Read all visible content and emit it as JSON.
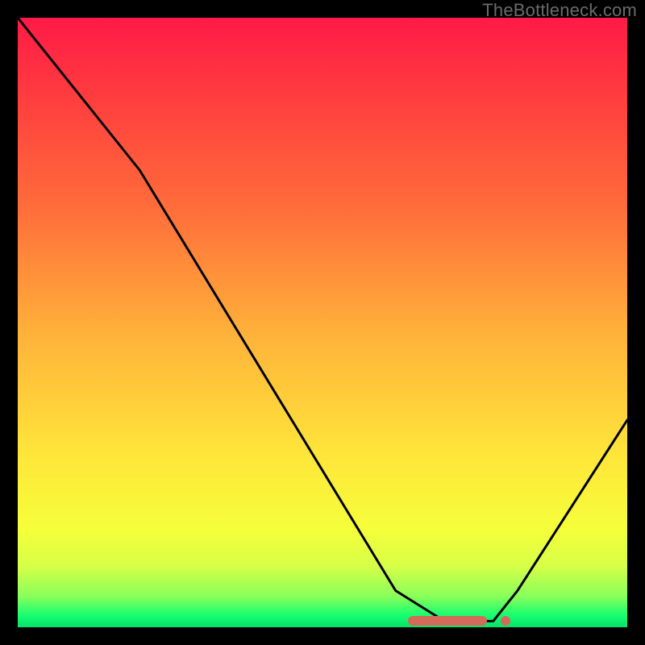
{
  "watermark": "TheBottleneck.com",
  "chart_data": {
    "type": "line",
    "title": "",
    "xlabel": "",
    "ylabel": "",
    "xlim": [
      0,
      100
    ],
    "ylim": [
      0,
      100
    ],
    "x": [
      0,
      20,
      62,
      70,
      78,
      82,
      100
    ],
    "y": [
      100,
      75,
      6,
      1,
      1,
      6,
      34
    ],
    "series": [
      {
        "name": "bottleneck-curve",
        "x": [
          0,
          20,
          62,
          70,
          78,
          82,
          100
        ],
        "y": [
          100,
          75,
          6,
          1,
          1,
          6,
          34
        ]
      }
    ],
    "markers": {
      "bar": {
        "x_start": 64,
        "x_end": 77,
        "y": 1
      },
      "dot": {
        "x": 80,
        "y": 1
      }
    },
    "colors": {
      "curve": "#000000",
      "marker": "#d46a5a",
      "gradient_top": "#ff1a47",
      "gradient_bottom": "#05e26a"
    }
  }
}
